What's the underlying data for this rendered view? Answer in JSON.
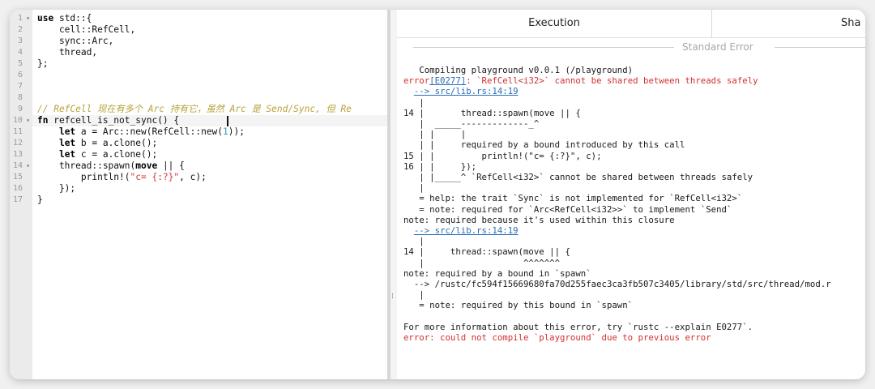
{
  "editor": {
    "line_numbers": [
      "1",
      "2",
      "3",
      "4",
      "5",
      "6",
      "7",
      "8",
      "9",
      "10",
      "11",
      "12",
      "13",
      "14",
      "15",
      "16",
      "17"
    ],
    "fold_markers": {
      "1": "▾",
      "10": "▾",
      "14": "▾"
    },
    "lines": [
      [
        {
          "t": "use",
          "c": "kw"
        },
        {
          "t": " std::{"
        }
      ],
      [
        {
          "t": "    cell::RefCell,"
        }
      ],
      [
        {
          "t": "    sync::Arc,"
        }
      ],
      [
        {
          "t": "    thread,"
        }
      ],
      [
        {
          "t": "};"
        }
      ],
      [],
      [],
      [],
      [
        {
          "t": "// RefCell 现在有多个 Arc 持有它，虽然 Arc 是 Send/Sync, 但 Re",
          "c": "cm"
        }
      ],
      [
        {
          "t": "fn",
          "c": "kw"
        },
        {
          "t": " refcell_is_not_sync() {"
        }
      ],
      [
        {
          "t": "    "
        },
        {
          "t": "let",
          "c": "kw"
        },
        {
          "t": " a = Arc::new(RefCell::new("
        },
        {
          "t": "1",
          "c": "nm"
        },
        {
          "t": "));"
        }
      ],
      [
        {
          "t": "    "
        },
        {
          "t": "let",
          "c": "kw"
        },
        {
          "t": " b = a.clone();"
        }
      ],
      [
        {
          "t": "    "
        },
        {
          "t": "let",
          "c": "kw"
        },
        {
          "t": " c = a.clone();"
        }
      ],
      [
        {
          "t": "    thread::spawn("
        },
        {
          "t": "move",
          "c": "kw"
        },
        {
          "t": " || {"
        }
      ],
      [
        {
          "t": "        println!("
        },
        {
          "t": "\"c= {:?}\"",
          "c": "st"
        },
        {
          "t": ", c);"
        }
      ],
      [
        {
          "t": "    });"
        }
      ],
      [
        {
          "t": "}"
        }
      ]
    ]
  },
  "output": {
    "tab_execution": "Execution",
    "tab_share": "Sha",
    "section_label": "Standard Error",
    "lines": [
      [
        {
          "t": "   Compiling playground v0.0.1 (/playground)"
        }
      ],
      [
        {
          "t": "error",
          "c": "err"
        },
        {
          "t": "[E0277]",
          "c": "lnk"
        },
        {
          "t": ": `RefCell<i32>` cannot be shared between threads safely",
          "c": "err"
        }
      ],
      [
        {
          "t": "  "
        },
        {
          "t": "--> src/lib.rs:14:19",
          "c": "lnk"
        }
      ],
      [
        {
          "t": "   |"
        }
      ],
      [
        {
          "t": "14 |       thread::spawn(move || {"
        }
      ],
      [
        {
          "t": "   |  _____-------------_^"
        }
      ],
      [
        {
          "t": "   | |     |"
        }
      ],
      [
        {
          "t": "   | |     required by a bound introduced by this call"
        }
      ],
      [
        {
          "t": "15 | |         println!(\"c= {:?}\", c);"
        }
      ],
      [
        {
          "t": "16 | |     });"
        }
      ],
      [
        {
          "t": "   | |_____^ `RefCell<i32>` cannot be shared between threads safely"
        }
      ],
      [
        {
          "t": "   |"
        }
      ],
      [
        {
          "t": "   = help: the trait `Sync` is not implemented for `RefCell<i32>`"
        }
      ],
      [
        {
          "t": "   = note: required for `Arc<RefCell<i32>>` to implement `Send`"
        }
      ],
      [
        {
          "t": "note: required because it's used within this closure"
        }
      ],
      [
        {
          "t": "  "
        },
        {
          "t": "--> src/lib.rs:14:19",
          "c": "lnk"
        }
      ],
      [
        {
          "t": "   |"
        }
      ],
      [
        {
          "t": "14 |     thread::spawn(move || {"
        }
      ],
      [
        {
          "t": "   |                   ^^^^^^^"
        }
      ],
      [
        {
          "t": "note: required by a bound in `spawn`"
        }
      ],
      [
        {
          "t": "  --> /rustc/fc594f15669680fa70d255faec3ca3fb507c3405/library/std/src/thread/mod.r"
        }
      ],
      [
        {
          "t": "   |"
        }
      ],
      [
        {
          "t": "   = note: required by this bound in `spawn`"
        }
      ],
      [],
      [
        {
          "t": "For more information about this error, try `rustc --explain E0277`."
        }
      ],
      [
        {
          "t": "error: could not compile `playground` due to previous error",
          "c": "err"
        }
      ]
    ]
  }
}
